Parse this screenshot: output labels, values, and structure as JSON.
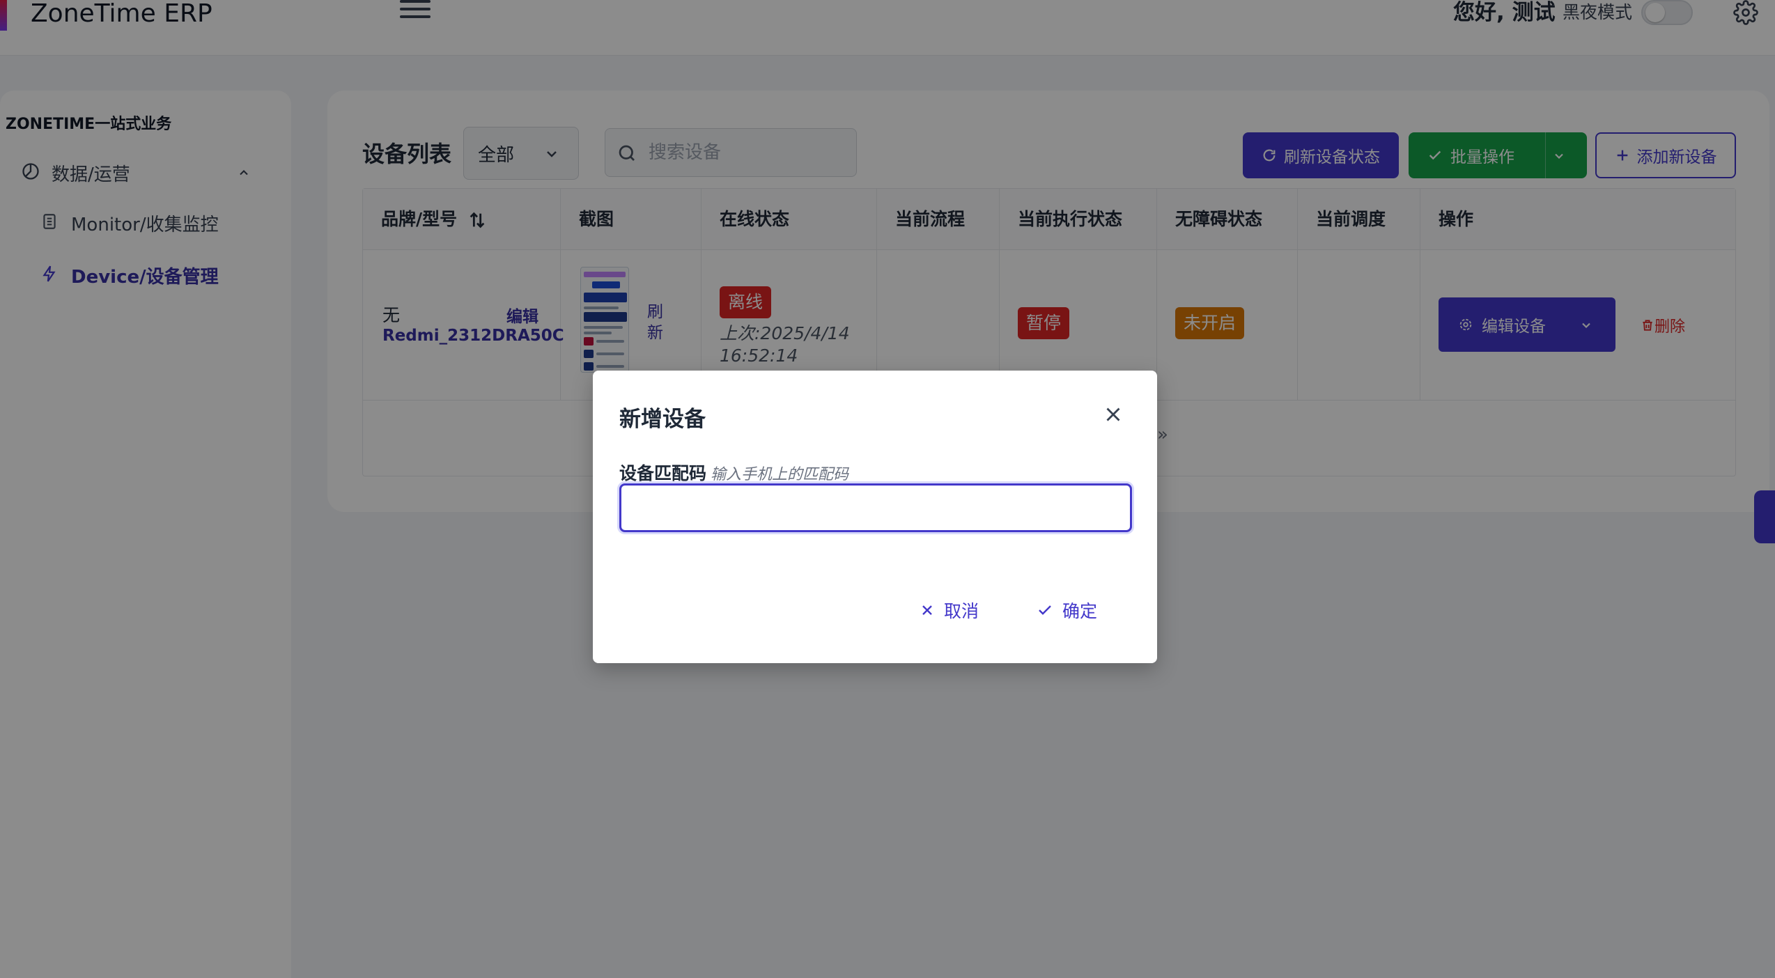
{
  "app": {
    "title": "ZoneTime ERP",
    "greeting": "您好, 测试",
    "dark_mode_label": "黑夜模式"
  },
  "sidebar": {
    "section_title": "ZONETIME一站式业务",
    "group_label": "数据/运营",
    "items": [
      {
        "label": "Monitor/收集监控",
        "active": false
      },
      {
        "label": "Device/设备管理",
        "active": true
      }
    ]
  },
  "toolbar": {
    "title": "设备列表",
    "filter_value": "全部",
    "search_placeholder": "搜索设备",
    "refresh_label": "刷新设备状态",
    "batch_label": "批量操作",
    "add_label": "添加新设备"
  },
  "table": {
    "headers": [
      "品牌/型号",
      "截图",
      "在线状态",
      "当前流程",
      "当前执行状态",
      "无障碍状态",
      "当前调度",
      "操作"
    ],
    "rows": [
      {
        "brand": "无",
        "edit_label": "编辑",
        "model": "Redmi_2312DRA50C",
        "refresh_label": "刷新",
        "online_status": "离线",
        "last_seen": "上次:2025/4/14 16:52:14",
        "current_flow": "",
        "exec_status": "暂停",
        "accessibility_status": "未开启",
        "schedule": "",
        "edit_device_label": "编辑设备",
        "delete_label": "删除"
      }
    ],
    "pager_symbol": "»"
  },
  "modal": {
    "title": "新增设备",
    "field_label": "设备匹配码",
    "field_hint": "输入手机上的匹配码",
    "field_value": "",
    "cancel_label": "取消",
    "confirm_label": "确定"
  },
  "colors": {
    "primary": "#4338ca",
    "success": "#16a34a",
    "danger": "#dc2626",
    "warning": "#d97706"
  }
}
